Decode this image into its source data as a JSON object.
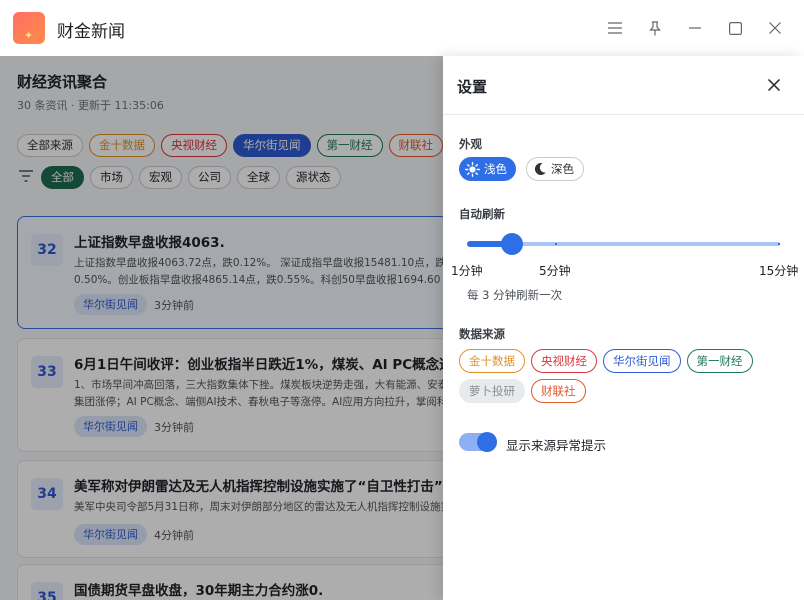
{
  "app": {
    "title": "财金新闻"
  },
  "main": {
    "title": "财经资讯聚合",
    "subtitle": "30 条资讯 · 更新于 11:35:06",
    "source_filters": [
      {
        "label": "全部来源",
        "color": "#333333",
        "border": "#c8ccd2"
      },
      {
        "label": "金十数据",
        "color": "#e0922a",
        "border": "#e0922a"
      },
      {
        "label": "央视财经",
        "color": "#d9363e",
        "border": "#d9363e"
      },
      {
        "label": "华尔街见闻",
        "color": "#ffffff",
        "border": "#2f5bd3",
        "bg": "#2f5bd3"
      },
      {
        "label": "第一财经",
        "color": "#1e7a5c",
        "border": "#1e7a5c"
      },
      {
        "label": "财联社",
        "color": "#e05a2b",
        "border": "#e05a2b"
      }
    ],
    "category_filters": [
      {
        "label": "全部",
        "active": true
      },
      {
        "label": "市场"
      },
      {
        "label": "宏观"
      },
      {
        "label": "公司"
      },
      {
        "label": "全球"
      },
      {
        "label": "源状态"
      }
    ],
    "news": [
      {
        "num": "32",
        "title": "上证指数早盘收报4063.",
        "body": "上证指数早盘收报4063.72点，跌0.12%。 深证成指早盘收报15481.10点，跌0.50%。创业板指早盘收报4865.14点，跌0.55%。科创50早盘收报1694.60点，跌3.24%。 中证500早盘收报",
        "tag": "华尔街见闻",
        "time": "3分钟前"
      },
      {
        "num": "33",
        "title": "6月1日午间收评：创业板指半日跌近1%，煤炭、AI PC概念逆势走强",
        "body": "1、市场早间冲高回落，三大指数集体下挫。煤炭板块逆势走强，大有能源、安泰集团涨停；AI PC概念、端侧AI技术、春秋电子等涨停。AI应用方向拉升，掌阅科技、视觉中国、税友股份等涨超",
        "tag": "华尔街见闻",
        "time": "3分钟前"
      },
      {
        "num": "34",
        "title": "美军称对伊朗雷达及无人机指挥控制设施实施了“自卫性打击”",
        "body": "美军中央司令部5月31日称，周末对伊朗部分地区的雷达及无人机指挥控制设施实施了打击。",
        "tag": "华尔街见闻",
        "time": "4分钟前"
      },
      {
        "num": "35",
        "title": "国债期货早盘收盘，30年期主力合约涨0.",
        "body": "",
        "tag": "",
        "time": ""
      }
    ]
  },
  "settings": {
    "title": "设置",
    "appearance_label": "外观",
    "theme_light": "浅色",
    "theme_dark": "深色",
    "theme_selected": "浅色",
    "refresh_label": "自动刷新",
    "refresh_min": "1分钟",
    "refresh_mid": "5分钟",
    "refresh_max": "15分钟",
    "refresh_value_min": 3,
    "refresh_note": "每 3 分钟刷新一次",
    "sources_label": "数据来源",
    "sources": [
      {
        "label": "金十数据",
        "color": "#e0922a",
        "border": "#e0922a"
      },
      {
        "label": "央视财经",
        "color": "#d9363e",
        "border": "#d9363e"
      },
      {
        "label": "华尔街见闻",
        "color": "#2f5bd3",
        "border": "#2f5bd3"
      },
      {
        "label": "第一财经",
        "color": "#1e7a5c",
        "border": "#1e7a5c"
      },
      {
        "label": "萝卜投研",
        "color": "#8a8f96",
        "border": "#e9eaec",
        "bg": "#e9eaec"
      },
      {
        "label": "财联社",
        "color": "#e05a2b",
        "border": "#e05a2b"
      }
    ],
    "alert_label": "显示来源异常提示",
    "alert_enabled": true
  },
  "colors": {
    "accent": "#2f6fe6",
    "card_active_border": "#3b6fe0"
  },
  "icons": [
    "menu-icon",
    "pin-icon",
    "minimize-icon",
    "maximize-icon",
    "close-icon",
    "filter-icon",
    "sun-icon",
    "moon-icon"
  ]
}
